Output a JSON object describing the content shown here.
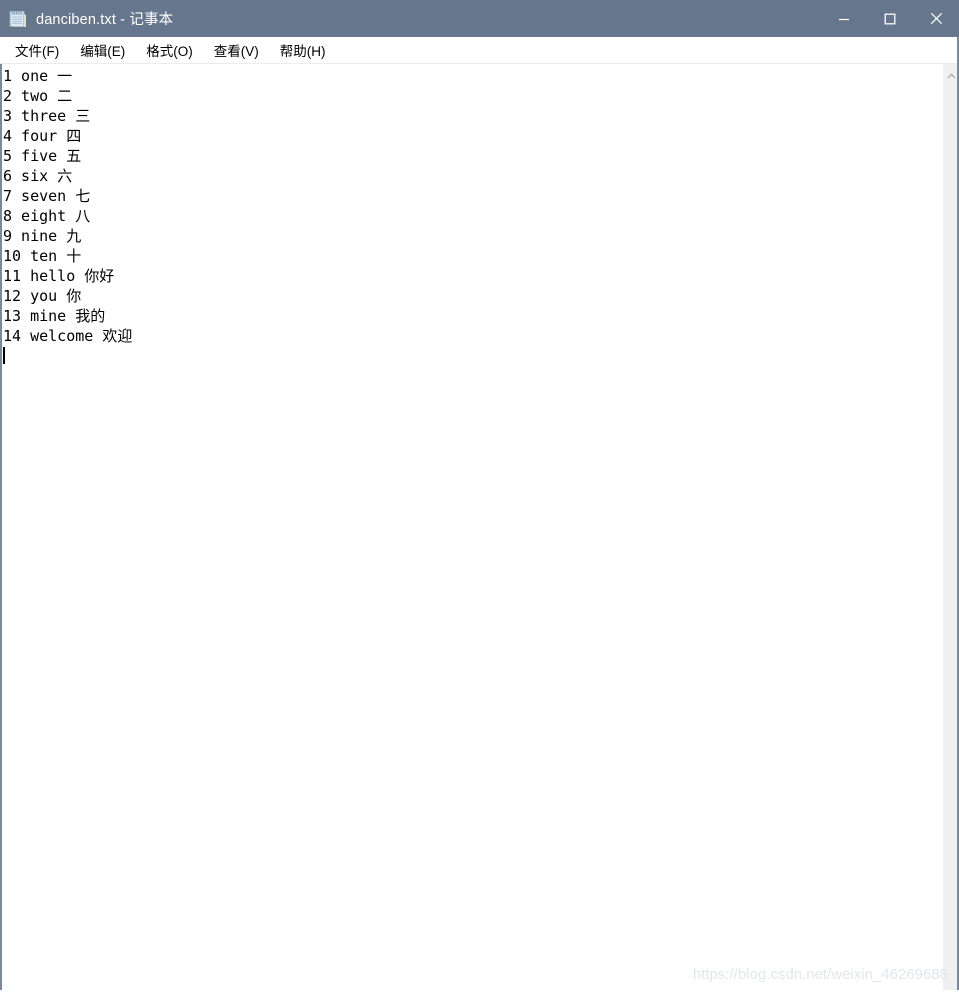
{
  "window": {
    "title": "danciben.txt - 记事本",
    "icon": "notepad-icon",
    "frame_color": "#7b899c",
    "titlebar_color": "#66768c"
  },
  "titlebar_buttons": {
    "minimize": "minimize-icon",
    "maximize": "maximize-icon",
    "close": "close-icon"
  },
  "menubar": {
    "items": [
      {
        "label": "文件(F)"
      },
      {
        "label": "编辑(E)"
      },
      {
        "label": "格式(O)"
      },
      {
        "label": "查看(V)"
      },
      {
        "label": "帮助(H)"
      }
    ]
  },
  "editor": {
    "lines": [
      "1 one 一",
      "2 two 二",
      "3 three 三",
      "4 four 四",
      "5 five 五",
      "6 six 六",
      "7 seven 七",
      "8 eight 八",
      "9 nine 九",
      "10 ten 十",
      "11 hello 你好",
      "12 you 你",
      "13 mine 我的",
      "14 welcome 欢迎"
    ],
    "caret_line": 15,
    "caret_column": 1
  },
  "scrollbar": {
    "up_arrow": "chevron-up-icon",
    "down_arrow": "chevron-down-icon",
    "track_color": "#f0f0f0"
  },
  "watermark": {
    "text": "https://blog.csdn.net/weixin_46269688"
  }
}
